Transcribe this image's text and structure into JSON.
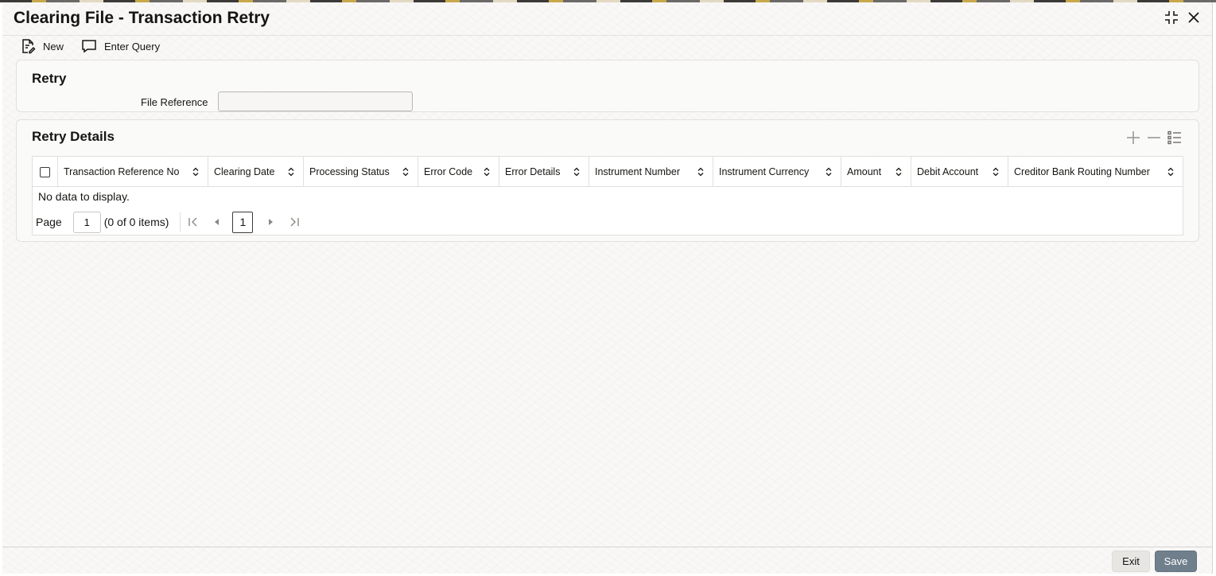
{
  "window": {
    "title": "Clearing File - Transaction Retry",
    "controls": [
      {
        "icon": "collapse-icon"
      },
      {
        "icon": "close-icon"
      }
    ]
  },
  "toolbar": {
    "new_label": "New",
    "enter_query_label": "Enter Query"
  },
  "retry": {
    "section_title": "Retry",
    "file_reference_label": "File Reference",
    "file_reference_value": ""
  },
  "retry_details": {
    "section_title": "Retry Details",
    "tools": [
      "add-row-icon",
      "delete-row-icon",
      "list-view-icon"
    ],
    "columns": [
      "Transaction Reference No",
      "Clearing Date",
      "Processing Status",
      "Error Code",
      "Error Details",
      "Instrument Number",
      "Instrument Currency",
      "Amount",
      "Debit Account",
      "Creditor Bank Routing Number"
    ],
    "rows": [],
    "empty_message": "No data to display.",
    "pagination": {
      "page_label": "Page",
      "page_value": "1",
      "count_text": "(0 of 0 items)",
      "current_page": "1"
    }
  },
  "footer": {
    "exit_label": "Exit",
    "save_label": "Save"
  },
  "colors": {
    "save_button_bg": "#6f7f8c",
    "exit_button_bg": "#e8e6e3",
    "text": "#161513"
  }
}
